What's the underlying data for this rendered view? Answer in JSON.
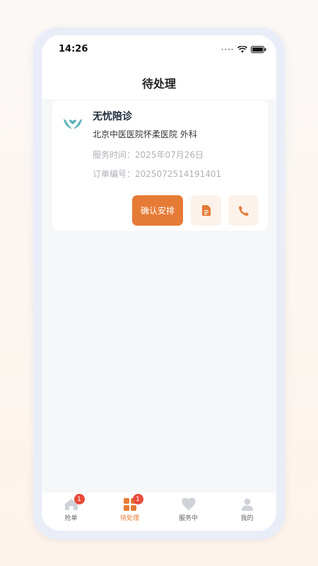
{
  "status_bar": {
    "time": "14:26"
  },
  "header": {
    "title": "待处理"
  },
  "order": {
    "service_name": "无忧陪诊",
    "hospital": "北京中医医院怀柔医院 外科",
    "service_time_label": "服务时间：",
    "service_time": "2025年07月26日",
    "order_no_label": "订单编号：",
    "order_no": "2025072514191401",
    "confirm_label": "确认安排"
  },
  "tabs": [
    {
      "label": "抢单",
      "badge": "1",
      "icon": "home-icon"
    },
    {
      "label": "待处理",
      "badge": "1",
      "icon": "grid-icon",
      "active": true
    },
    {
      "label": "服务中",
      "icon": "heart-icon"
    },
    {
      "label": "我的",
      "icon": "user-icon"
    }
  ],
  "colors": {
    "accent": "#e67b36",
    "badge": "#e84a3a",
    "logo": "#5bb3b8"
  }
}
